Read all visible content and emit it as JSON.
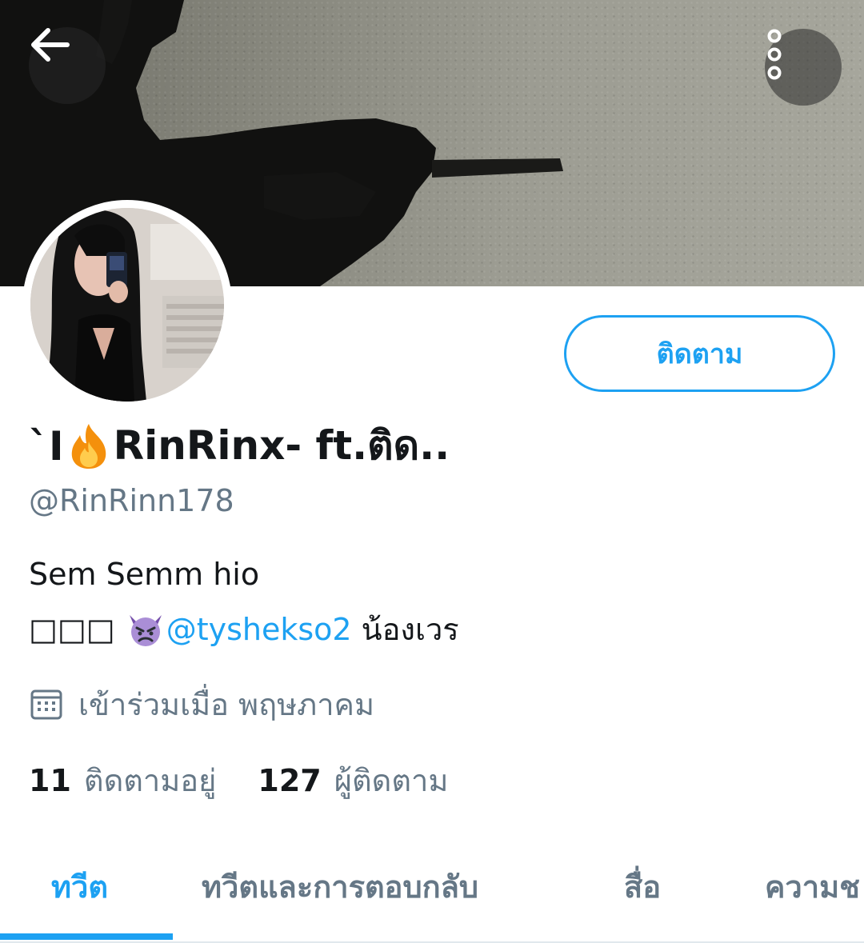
{
  "profile": {
    "display_name_prefix": "`I",
    "display_name_suffix": "RinRinx- ft.ติด..",
    "handle": "@RinRinn178",
    "bio_line1": "Sem Semm hio",
    "bio_line2_prefix": "□□□",
    "bio_mention": "@tyshekso2",
    "bio_line2_suffix": "น้องเวร",
    "joined": "เข้าร่วมเมื่อ พฤษภาคม",
    "following_count": "11",
    "following_label": "ติดตามอยู่",
    "followers_count": "127",
    "followers_label": "ผู้ติดตาม"
  },
  "actions": {
    "follow_label": "ติดตาม"
  },
  "tabs": [
    {
      "label": "ทวีต",
      "active": true
    },
    {
      "label": "ทวีตและการตอบกลับ",
      "active": false
    },
    {
      "label": "สื่อ",
      "active": false
    },
    {
      "label": "ความช",
      "active": false
    }
  ],
  "icons": {
    "back": "arrow-left-icon",
    "more": "more-vertical-icon",
    "fire": "fire-emoji-icon",
    "devil": "devil-emoji-icon",
    "calendar": "calendar-icon"
  },
  "colors": {
    "accent": "#1da1f2",
    "text": "#14171a",
    "secondary": "#657786",
    "border": "#e1e8ed"
  }
}
